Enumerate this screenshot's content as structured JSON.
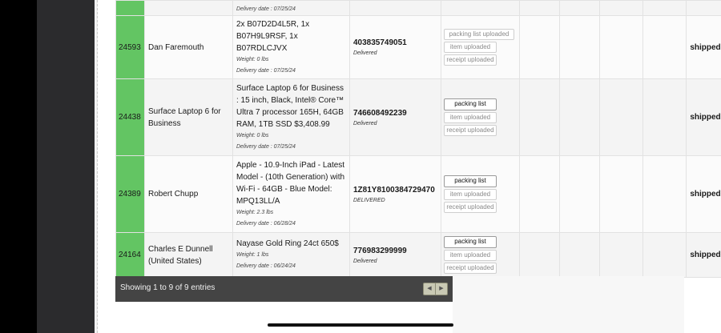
{
  "top_row": {
    "delivery": "Delivery date : 07/25/24"
  },
  "rows": [
    {
      "id": "24593",
      "name": "Dan Faremouth",
      "description": "2x B07D2D4L5R, 1x B07H9L9RSF, 1x B07RDLCJVX",
      "weight": "Weight: 0 lbs",
      "delivery": "Delivery date : 07/25/24",
      "tracking": "403835749051",
      "tracking_status": "Delivered",
      "docs": [
        "packing list uploaded",
        "item uploaded",
        "receipt uploaded"
      ],
      "status": "shipped"
    },
    {
      "id": "24438",
      "name": "Surface Laptop 6 for Business",
      "description": "Surface Laptop 6 for Business : 15 inch, Black, Intel® Core™ Ultra 7 processor 165H, 64GB RAM, 1TB SSD $3,408.99",
      "weight": "Weight: 0 lbs",
      "delivery": "Delivery date : 07/25/24",
      "tracking": "746608492239",
      "tracking_status": "Delivered",
      "docs": [
        "packing list",
        "item uploaded",
        "receipt uploaded"
      ],
      "status": "shipped"
    },
    {
      "id": "24389",
      "name": "Robert Chupp",
      "description": "Apple - 10.9-Inch iPad - Latest Model - (10th Generation) with Wi-Fi - 64GB - Blue Model: MPQ13LL/A",
      "weight": "Weight: 2.3 lbs",
      "delivery": "Delivery date : 06/28/24",
      "tracking": "1Z81Y8100384729470",
      "tracking_status": "DELIVERED",
      "docs": [
        "packing list",
        "item uploaded",
        "receipt uploaded"
      ],
      "status": "shipped"
    },
    {
      "id": "24164",
      "name": "Charles E Dunnell (United States)",
      "description": "Nayase Gold Ring 24ct 650$",
      "weight": "Weight: 1 lbs",
      "delivery": "Delivery date : 06/24/24",
      "tracking": "776983299999",
      "tracking_status": "Delivered",
      "docs": [
        "packing list",
        "item uploaded",
        "receipt uploaded"
      ],
      "status": "shipped"
    }
  ],
  "footer": {
    "info": "Showing 1 to 9 of 9 entries",
    "prev_icon": "chevron-left-icon",
    "next_icon": "chevron-right-icon"
  },
  "colors": {
    "id_cell": "#63c563",
    "footer_bg": "#444444"
  }
}
